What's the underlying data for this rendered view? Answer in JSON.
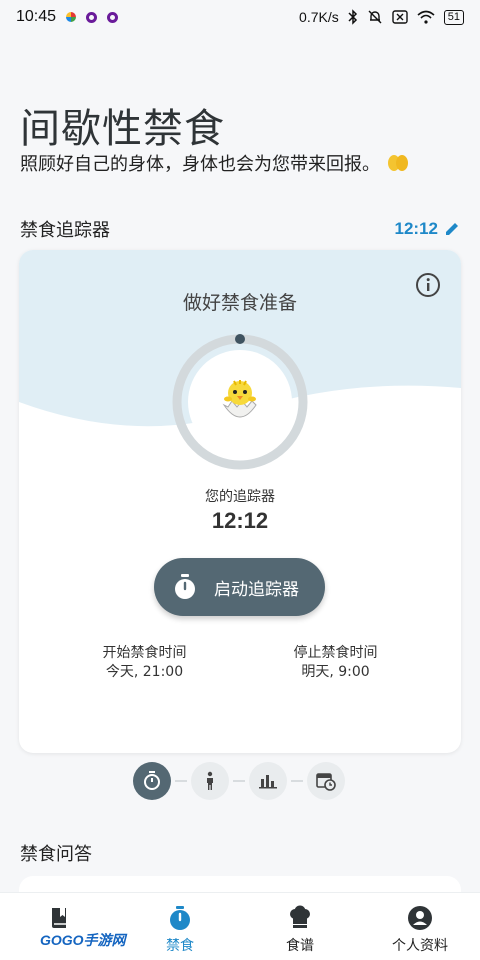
{
  "status_bar": {
    "time": "10:45",
    "net_speed": "0.7K/s",
    "battery": "51"
  },
  "header": {
    "title": "间歇性禁食",
    "subtitle": "照顾好自己的身体，身体也会为您带来回报。"
  },
  "tracker_section": {
    "title": "禁食追踪器",
    "time_link": "12:12"
  },
  "tracker_card": {
    "heading": "做好禁食准备",
    "your_tracker_label": "您的追踪器",
    "your_tracker_value": "12:12",
    "start_button": "启动追踪器",
    "start_label": "开始禁食时间",
    "start_value": "今天, 21:00",
    "stop_label": "停止禁食时间",
    "stop_value": "明天, 9:00"
  },
  "stepper": {
    "active_index": 0,
    "steps": [
      "timer-icon",
      "walking-icon",
      "bar-chart-icon",
      "calendar-clock-icon"
    ]
  },
  "qa_section": {
    "title": "禁食问答"
  },
  "bottom_nav": {
    "items": [
      {
        "label": "",
        "icon": "book-icon"
      },
      {
        "label": "禁食",
        "icon": "timer-icon"
      },
      {
        "label": "食谱",
        "icon": "chef-hat-icon"
      },
      {
        "label": "个人资料",
        "icon": "profile-icon"
      }
    ],
    "active_index": 1
  },
  "watermark": "GOGO手游网",
  "colors": {
    "accent": "#1e88c8",
    "button": "#546873",
    "wave": "#e0eef5"
  }
}
